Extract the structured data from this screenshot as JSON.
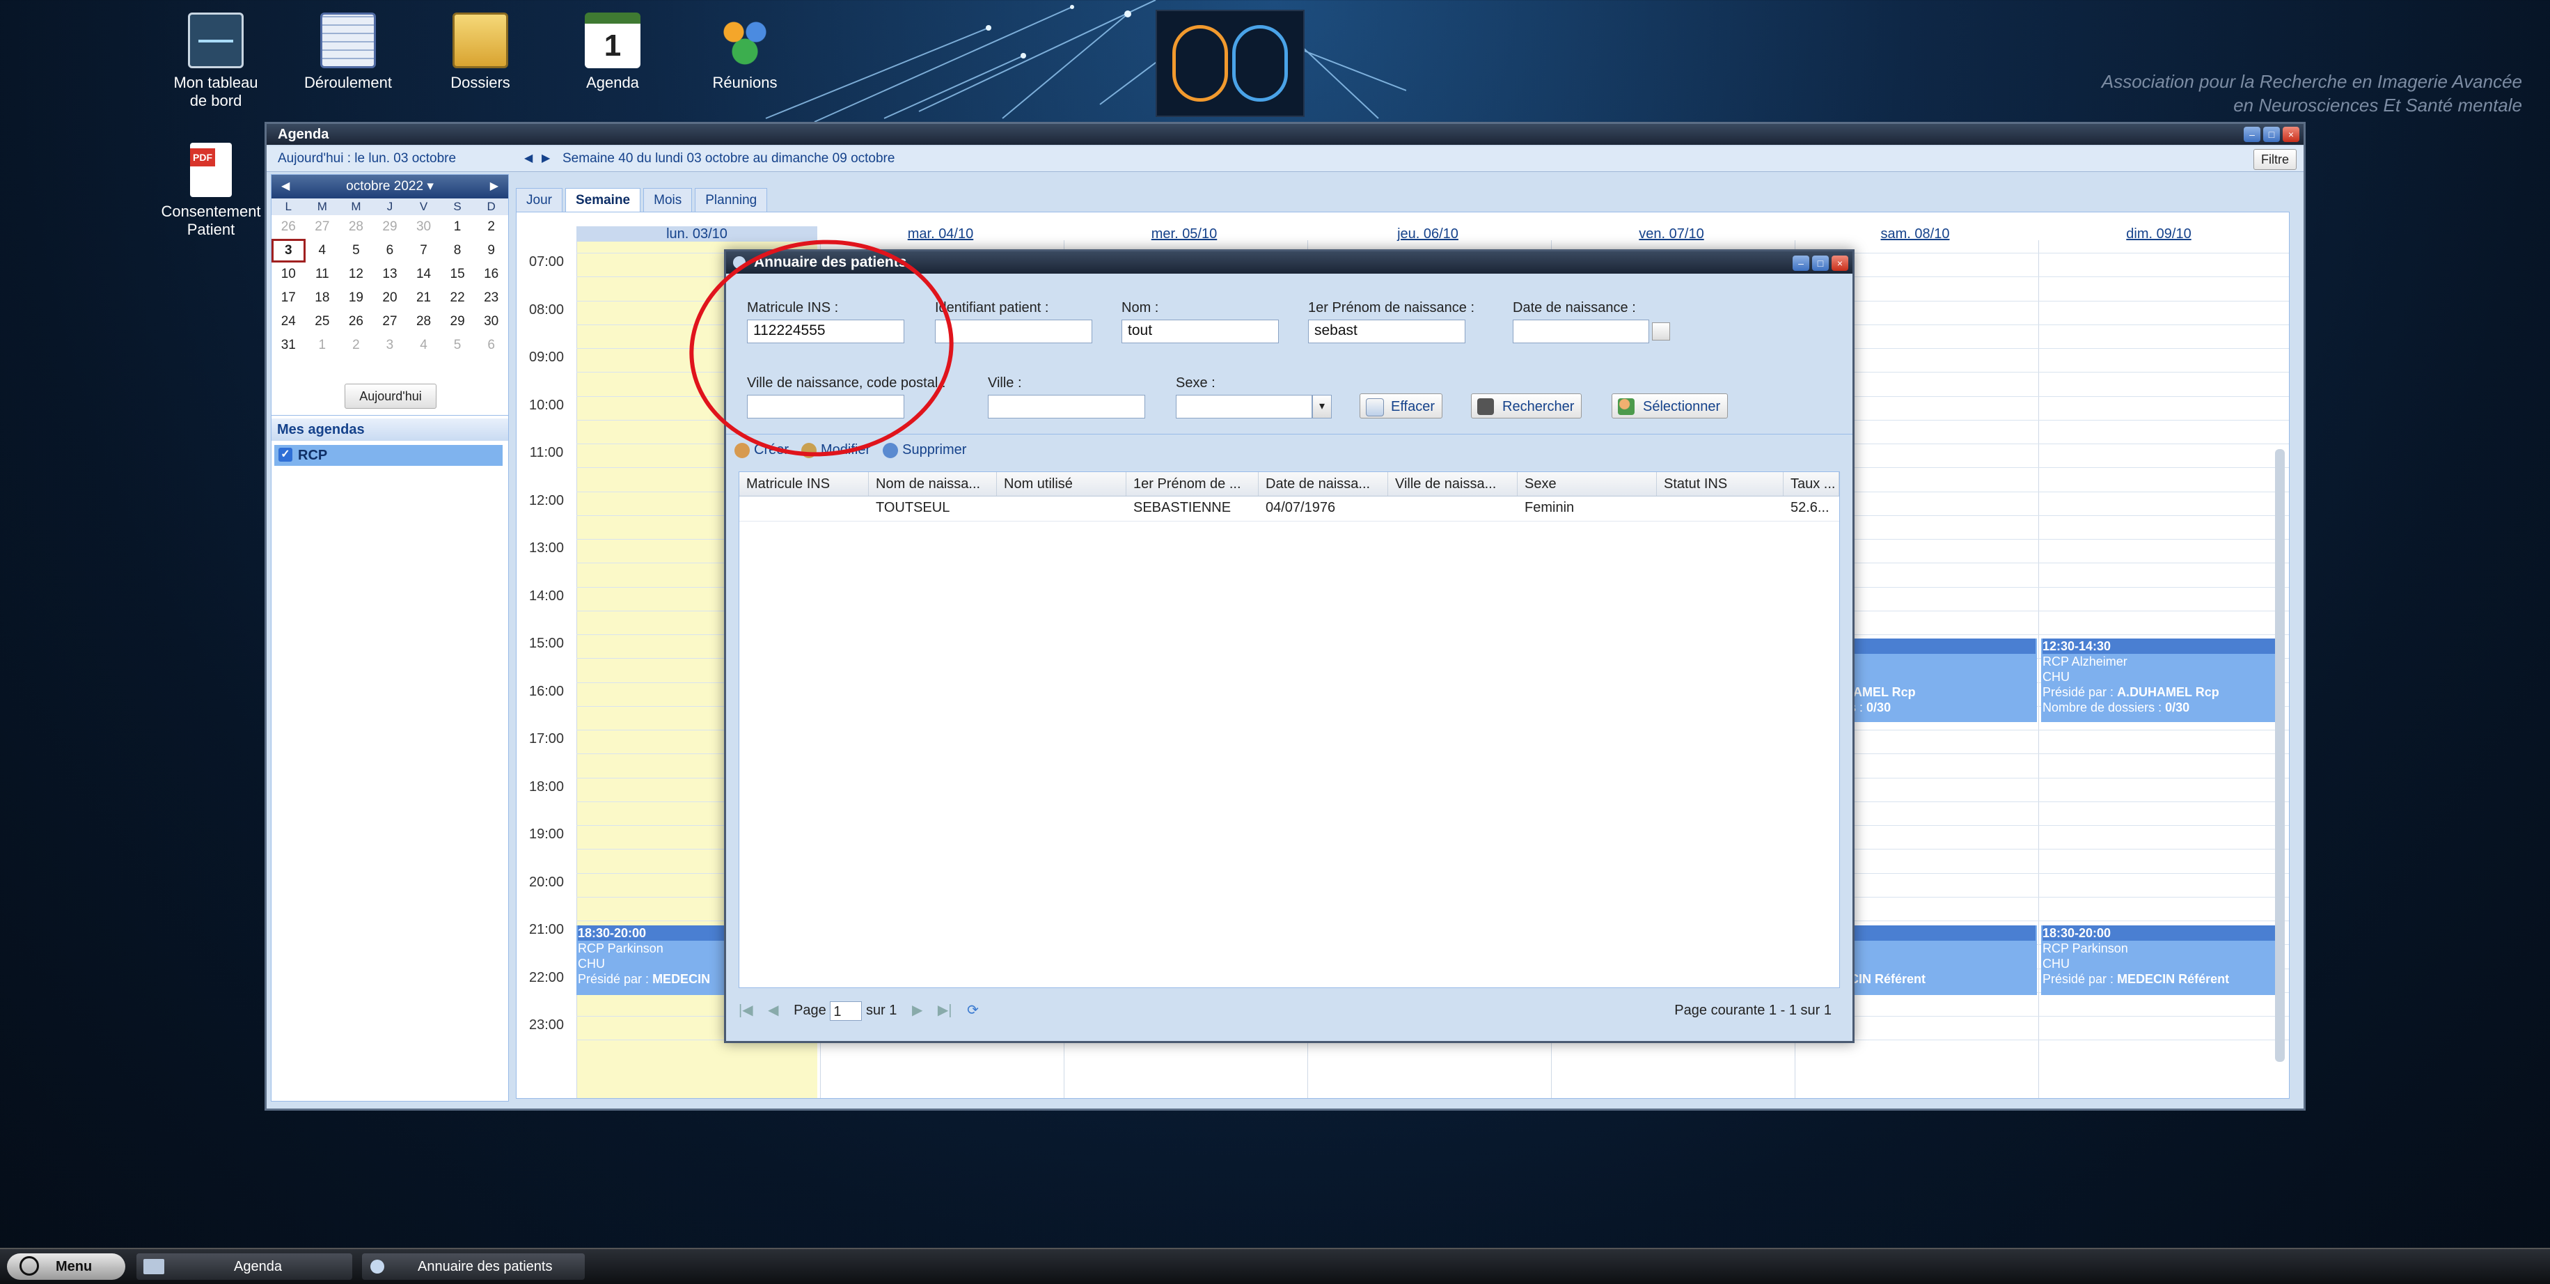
{
  "desktop": {
    "icons": [
      {
        "label": "Mon tableau de bord"
      },
      {
        "label": "Déroulement"
      },
      {
        "label": "Dossiers"
      },
      {
        "label": "Agenda",
        "glyph": "1"
      },
      {
        "label": "Réunions"
      }
    ],
    "pdf_icon": {
      "label": "Consentement Patient"
    },
    "association_line1": "Association pour la Recherche en Imagerie Avancée",
    "association_line2": "en Neurosciences Et Santé mentale"
  },
  "agenda_window": {
    "title": "Agenda",
    "today_text": "Aujourd'hui : le lun. 03 octobre",
    "week_text": "Semaine 40 du lundi 03 octobre au dimanche 09 octobre",
    "filter_label": "Filtre",
    "minical": {
      "month": "octobre 2022",
      "weekday_headers": [
        "L",
        "M",
        "M",
        "J",
        "V",
        "S",
        "D"
      ],
      "weeks": [
        [
          "26",
          "27",
          "28",
          "29",
          "30",
          "1",
          "2"
        ],
        [
          "3",
          "4",
          "5",
          "6",
          "7",
          "8",
          "9"
        ],
        [
          "10",
          "11",
          "12",
          "13",
          "14",
          "15",
          "16"
        ],
        [
          "17",
          "18",
          "19",
          "20",
          "21",
          "22",
          "23"
        ],
        [
          "24",
          "25",
          "26",
          "27",
          "28",
          "29",
          "30"
        ],
        [
          "31",
          "1",
          "2",
          "3",
          "4",
          "5",
          "6"
        ]
      ],
      "today_button": "Aujourd'hui"
    },
    "mes_agendas": "Mes agendas",
    "agenda_item": "RCP",
    "tabs": [
      {
        "label": "Jour",
        "active": false
      },
      {
        "label": "Semaine",
        "active": true
      },
      {
        "label": "Mois",
        "active": false
      },
      {
        "label": "Planning",
        "active": false
      }
    ],
    "days": [
      "lun. 03/10",
      "mar. 04/10",
      "mer. 05/10",
      "jeu. 06/10",
      "ven. 07/10",
      "sam. 08/10",
      "dim. 09/10"
    ],
    "hours": [
      "07:00",
      "08:00",
      "09:00",
      "10:00",
      "11:00",
      "12:00",
      "13:00",
      "14:00",
      "15:00",
      "16:00",
      "17:00",
      "18:00",
      "19:00",
      "20:00",
      "21:00",
      "22:00",
      "23:00"
    ],
    "events": {
      "sat_alz": {
        "time": "0",
        "title": "imer",
        "line3": "",
        "line4_prefix": "r : ",
        "line4_bold": "A.DUHAMEL Rcp",
        "line5_prefix": "e dossiers : ",
        "line5_bold": "0/30"
      },
      "sun_alz": {
        "time": "12:30-14:30",
        "title": "RCP Alzheimer",
        "line3": "CHU",
        "line4_prefix": "Présidé par : ",
        "line4_bold": "A.DUHAMEL Rcp",
        "line5_prefix": "Nombre de dossiers : ",
        "line5_bold": "0/30"
      },
      "mon_park": {
        "time": "18:30-20:00",
        "title": "RCP Parkinson",
        "line3": "CHU",
        "line4_prefix": "Présidé par : ",
        "line4_bold": "MEDECIN"
      },
      "sat_park": {
        "time": "0",
        "title": "nson",
        "line3": "",
        "line4_prefix": "r : ",
        "line4_bold": "MEDECIN Référent"
      },
      "sun_park": {
        "time": "18:30-20:00",
        "title": "RCP Parkinson",
        "line3": "CHU",
        "line4_prefix": "Présidé par : ",
        "line4_bold": "MEDECIN Référent"
      }
    }
  },
  "annuaire": {
    "title": "Annuaire des patients",
    "fields": {
      "matricule_label": "Matricule INS :",
      "matricule_value": "112224555",
      "identifiant_label": "Identifiant patient :",
      "identifiant_value": "",
      "nom_label": "Nom :",
      "nom_value": "tout",
      "prenom_label": "1er Prénom de naissance :",
      "prenom_value": "sebast",
      "date_label": "Date de naissance :",
      "date_value": "",
      "ville_naiss_label": "Ville de naissance, code postal :",
      "ville_naiss_value": "",
      "ville_label": "Ville :",
      "ville_value": "",
      "sexe_label": "Sexe :",
      "sexe_value": ""
    },
    "buttons": {
      "effacer": "Effacer",
      "rechercher": "Rechercher",
      "selectionner": "Sélectionner"
    },
    "toolbar": {
      "creer": "Créer",
      "modifier": "Modifier",
      "supprimer": "Supprimer"
    },
    "columns": [
      "Matricule INS",
      "Nom de naissa...",
      "Nom utilisé",
      "1er Prénom de ...",
      "Date de naissa...",
      "Ville de naissa...",
      "Sexe",
      "Statut INS",
      "Taux ..."
    ],
    "rows": [
      {
        "matricule": "",
        "nom_naissance": "TOUTSEUL",
        "nom_utilise": "",
        "prenom": "SEBASTIENNE",
        "date_naissance": "04/07/1976",
        "ville_naissance": "",
        "sexe": "Feminin",
        "statut": "",
        "taux": "52.6..."
      }
    ],
    "pager": {
      "page_label": "Page",
      "page_value": "1",
      "total": "sur 1",
      "info": "Page courante 1 - 1 sur 1"
    }
  },
  "taskbar": {
    "menu": "Menu",
    "agenda": "Agenda",
    "annuaire": "Annuaire des patients"
  }
}
